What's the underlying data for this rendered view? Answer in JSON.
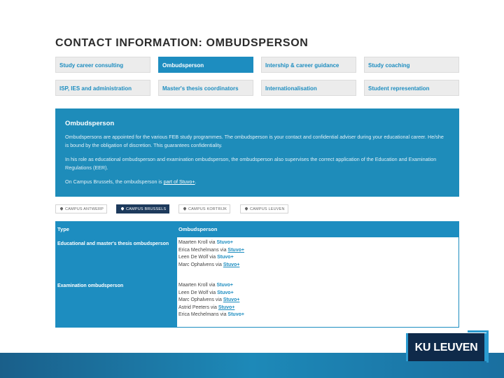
{
  "page": {
    "title": "CONTACT INFORMATION: OMBUDSPERSON"
  },
  "tabs": [
    {
      "label": "Study career consulting",
      "active": false
    },
    {
      "label": "Ombudsperson",
      "active": true
    },
    {
      "label": "Intership & career guidance",
      "active": false
    },
    {
      "label": "Study coaching",
      "active": false
    },
    {
      "label": "ISP, IES and administration",
      "active": false
    },
    {
      "label": "Master's thesis coordinators",
      "active": false
    },
    {
      "label": "Internationalisation",
      "active": false
    },
    {
      "label": "Student representation",
      "active": false
    }
  ],
  "info": {
    "title": "Ombudsperson",
    "p1": "Ombudspersons are appointed for the various FEB study programmes. The ombudsperson is your contact and confidential adviser during your educational career. He/she is bound by the obligation of discretion. This guarantees confidentiality.",
    "p2": "In his role as educational ombudsperson and examination ombudsperson, the ombudsperson also supervises the correct application of the Education and Examination Regulations (EER).",
    "p3_prefix": "On Campus Brussels, the ombudsperson is ",
    "p3_link": "part of Stuvo+",
    "p3_suffix": "."
  },
  "campuses": [
    {
      "label": "CAMPUS ANTWERP",
      "active": false
    },
    {
      "label": "CAMPUS BRUSSELS",
      "active": true
    },
    {
      "label": "CAMPUS KORTRIJK",
      "active": false
    },
    {
      "label": "CAMPUS LEUVEN",
      "active": false
    }
  ],
  "table": {
    "header_type": "Type",
    "header_person": "Ombudsperson",
    "rows": [
      {
        "type": "Educational and master's thesis ombudsperson",
        "people": [
          {
            "name": "Maarten Kroll via ",
            "link": "Stuvo+",
            "underline": false
          },
          {
            "name": "Erica Mechelmans via ",
            "link": "Stuvo+",
            "underline": true
          },
          {
            "name": "Leen De Wolf via ",
            "link": "Stuvo+",
            "underline": false
          },
          {
            "name": "Marc Ophalvens via ",
            "link": "Stuvo+",
            "underline": true
          }
        ]
      },
      {
        "type": "Examination ombudsperson",
        "people": [
          {
            "name": "Maarten Kroll via ",
            "link": "Stuvo+",
            "underline": false
          },
          {
            "name": "Leen De Wolf via ",
            "link": "Stuvo+",
            "underline": false
          },
          {
            "name": "Marc Ophalvens via ",
            "link": "Stuvo+",
            "underline": true
          },
          {
            "name": "Astrid Peeters via ",
            "link": "Stuvo+",
            "underline": true
          },
          {
            "name": "Erica Mechelmans via ",
            "link": "Stuvo+",
            "underline": false
          }
        ]
      }
    ]
  },
  "footer": {
    "logo_text": "KU LEUVEN"
  },
  "colors": {
    "accent": "#1d8dc0",
    "info_bg": "#1e8cba",
    "logo_bg": "#0f2a4a",
    "campus_active": "#1d3a5c"
  }
}
